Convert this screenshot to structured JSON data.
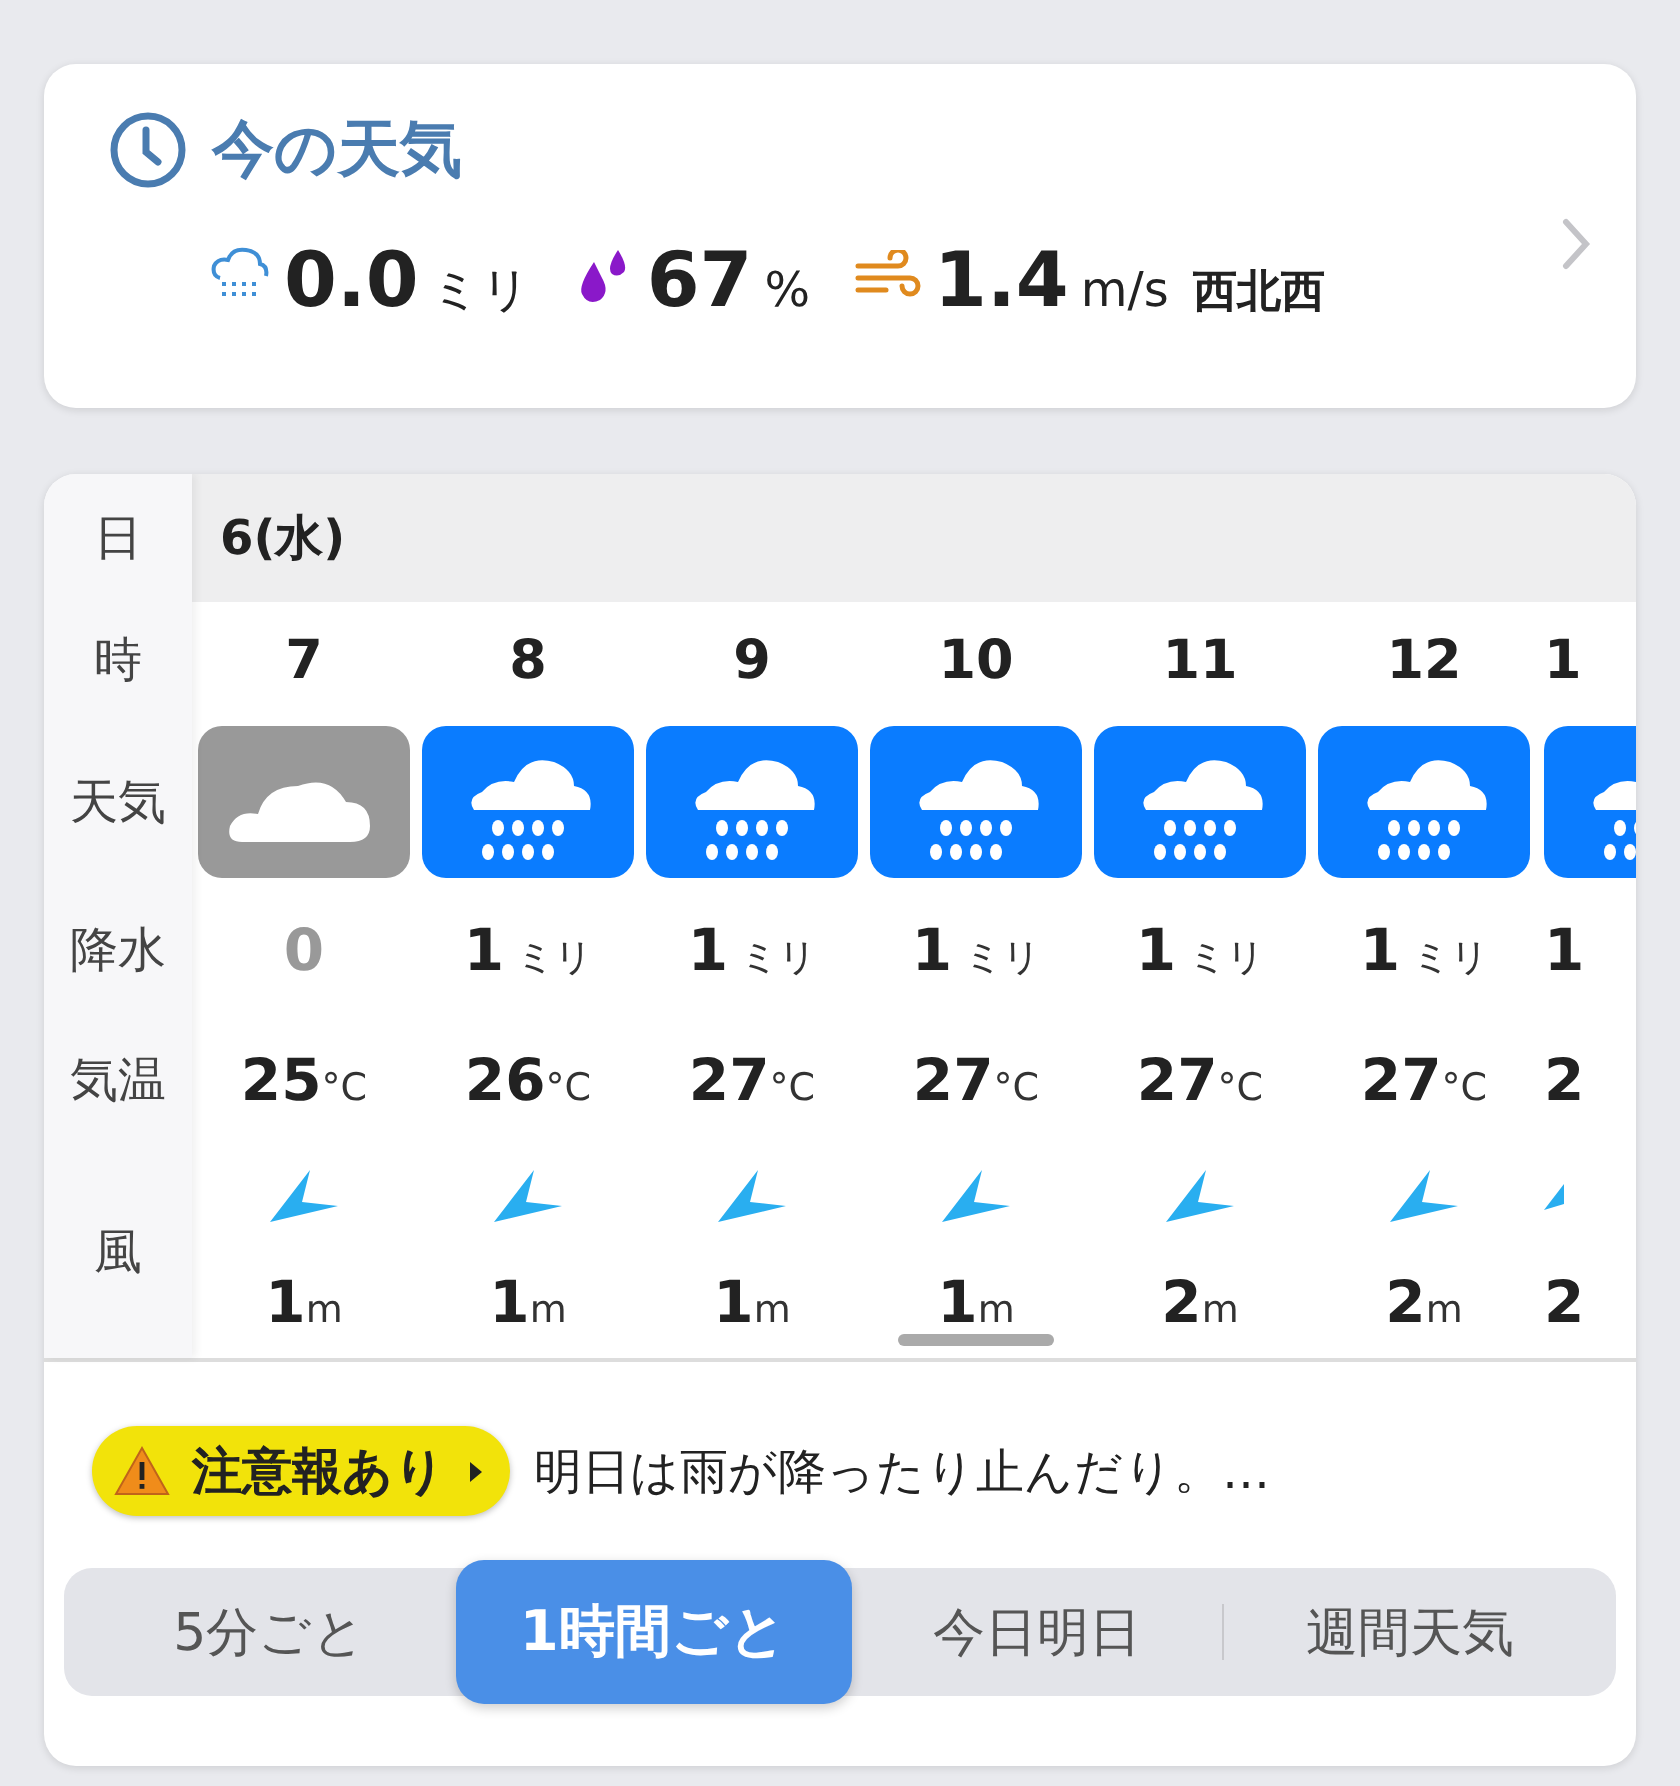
{
  "current": {
    "title": "今の天気",
    "precipitation": {
      "value": "0.0",
      "unit": "ミリ"
    },
    "humidity": {
      "value": "67",
      "unit": "%"
    },
    "wind": {
      "value": "1.4",
      "unit": "m/s",
      "direction": "西北西"
    }
  },
  "hourly": {
    "row_labels": [
      "日",
      "時",
      "天気",
      "降水",
      "気温",
      "風"
    ],
    "date": "6(水)",
    "hours": [
      {
        "hour": "7",
        "kind": "cloudy",
        "precip": "0",
        "precip_muted": true,
        "temp": "25",
        "temp_unit": "°C",
        "wind": "1",
        "wind_unit": "m"
      },
      {
        "hour": "8",
        "kind": "rain",
        "precip": "1",
        "precip_unit": "ミリ",
        "precip_muted": false,
        "temp": "26",
        "temp_unit": "°C",
        "wind": "1",
        "wind_unit": "m"
      },
      {
        "hour": "9",
        "kind": "rain",
        "precip": "1",
        "precip_unit": "ミリ",
        "precip_muted": false,
        "temp": "27",
        "temp_unit": "°C",
        "wind": "1",
        "wind_unit": "m"
      },
      {
        "hour": "10",
        "kind": "rain",
        "precip": "1",
        "precip_unit": "ミリ",
        "precip_muted": false,
        "temp": "27",
        "temp_unit": "°C",
        "wind": "1",
        "wind_unit": "m"
      },
      {
        "hour": "11",
        "kind": "rain",
        "precip": "1",
        "precip_unit": "ミリ",
        "precip_muted": false,
        "temp": "27",
        "temp_unit": "°C",
        "wind": "2",
        "wind_unit": "m"
      },
      {
        "hour": "12",
        "kind": "rain",
        "precip": "1",
        "precip_unit": "ミリ",
        "precip_muted": false,
        "temp": "27",
        "temp_unit": "°C",
        "wind": "2",
        "wind_unit": "m"
      },
      {
        "hour": "1",
        "kind": "rain",
        "precip": "1",
        "precip_muted": false,
        "temp": "2",
        "wind": "2"
      }
    ]
  },
  "alert": {
    "badge": "注意報あり",
    "text": "明日は雨が降ったり止んだり。…"
  },
  "tabs": [
    {
      "label": "5分ごと",
      "selected": false
    },
    {
      "label": "1時間ごと",
      "selected": true
    },
    {
      "label": "今日明日",
      "selected": false
    },
    {
      "label": "週間天気",
      "selected": false
    }
  ]
}
